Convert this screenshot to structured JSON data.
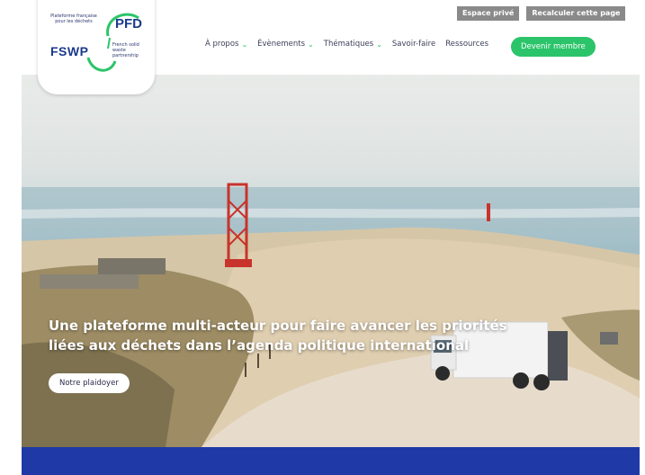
{
  "header": {
    "top_buttons": [
      "Espace privé",
      "Recalculer cette page"
    ],
    "nav": [
      {
        "label": "À propos",
        "dropdown": true
      },
      {
        "label": "Évènements",
        "dropdown": true
      },
      {
        "label": "Thématiques",
        "dropdown": true
      },
      {
        "label": "Savoir-faire",
        "dropdown": false
      },
      {
        "label": "Ressources",
        "dropdown": false
      }
    ],
    "cta": "Devenir membre"
  },
  "logo": {
    "pfd_text": "Plateforme française pour les déchets",
    "pfd": "PFD",
    "fswp": "FSWP",
    "fswp_text": "French solid waste partnership"
  },
  "hero": {
    "headline_line1": "Une plateforme multi-acteur pour faire avancer les priorités",
    "headline_line2": "liées aux déchets dans l’agenda politique international",
    "button": "Notre plaidoyer"
  },
  "colors": {
    "brand_green": "#2bc46a",
    "brand_blue": "#1f3aa6",
    "top_button_gray": "#8a8a8a"
  }
}
